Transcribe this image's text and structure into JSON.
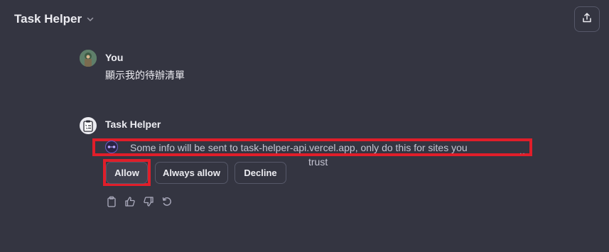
{
  "header": {
    "title": "Task Helper",
    "title_icon": "chevron-down-icon",
    "share_icon": "share-icon"
  },
  "messages": [
    {
      "author": "You",
      "text": "顯示我的待辦清單",
      "avatar": "user-avatar"
    },
    {
      "author": "Task Helper",
      "avatar": "clipboard-avatar"
    }
  ],
  "consent": {
    "icon": "plugin-icon",
    "text_line1": "Some info will be sent to task-helper-api.vercel.app, only do this for sites you",
    "text_line2": "trust",
    "more": "..",
    "buttons": {
      "allow": "Allow",
      "always_allow": "Always allow",
      "decline": "Decline"
    }
  },
  "feedback_icons": [
    "copy-icon",
    "thumbs-up-icon",
    "thumbs-down-icon",
    "regenerate-icon"
  ],
  "colors": {
    "background": "#343541",
    "text": "#ececf1",
    "highlight": "#e01e2a",
    "border": "#565869"
  }
}
